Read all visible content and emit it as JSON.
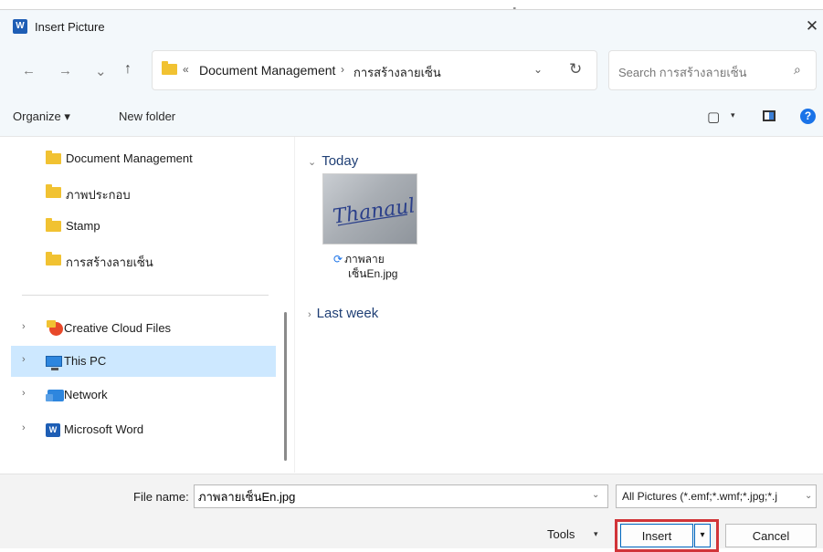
{
  "stray_mark": "ٍ",
  "window": {
    "title": "Insert Picture",
    "close_glyph": "✕",
    "app_icon": "W"
  },
  "nav": {
    "back_glyph": "←",
    "forward_glyph": "→",
    "recent_glyph": "⌄",
    "up_glyph": "↑"
  },
  "address": {
    "overflow": "«",
    "segments": [
      "Document Management",
      "การสร้างลายเซ็น"
    ],
    "separator": "›",
    "dropdown_glyph": "⌄",
    "refresh_glyph": "↻"
  },
  "search": {
    "placeholder": "Search การสร้างลายเซ็น",
    "icon_glyph": "⌕"
  },
  "toolbar": {
    "organize": "Organize ▾",
    "new_folder": "New folder",
    "view_glyph": "▢",
    "view_drop": "▾",
    "help_glyph": "?"
  },
  "sidebar": {
    "chevron": "›",
    "items": [
      {
        "label": "Document Management",
        "icon": "folder-icon"
      },
      {
        "label": "ภาพประกอบ",
        "icon": "folder-icon"
      },
      {
        "label": "Stamp",
        "icon": "folder-icon"
      },
      {
        "label": "การสร้างลายเซ็น",
        "icon": "folder-icon"
      },
      {
        "label": "Creative Cloud Files",
        "icon": "creative-cloud-icon"
      },
      {
        "label": "This PC",
        "icon": "computer-icon",
        "selected": true
      },
      {
        "label": "Network",
        "icon": "network-icon"
      },
      {
        "label": "Microsoft Word",
        "icon": "word-icon"
      }
    ]
  },
  "content": {
    "groups": [
      {
        "label": "Today",
        "chevron": "⌄"
      },
      {
        "label": "Last week",
        "chevron": "›"
      }
    ],
    "file": {
      "name_line1": "ภาพลาย",
      "name_line2": "เซ็นEn.jpg",
      "sync_glyph": "⟳",
      "signature_text": "Thanaul"
    }
  },
  "footer": {
    "file_name_label": "File name:",
    "file_name_value": "ภาพลายเซ็นEn.jpg",
    "drop_glyph": "⌄",
    "file_type": "All Pictures (*.emf;*.wmf;*.jpg;*.j",
    "tools": "Tools",
    "tools_drop": "▾",
    "insert": "Insert",
    "insert_split": "▾",
    "cancel": "Cancel"
  },
  "colors": {
    "accent": "#0067c0",
    "highlight": "#d13438",
    "selected_bg": "#cde8ff"
  }
}
